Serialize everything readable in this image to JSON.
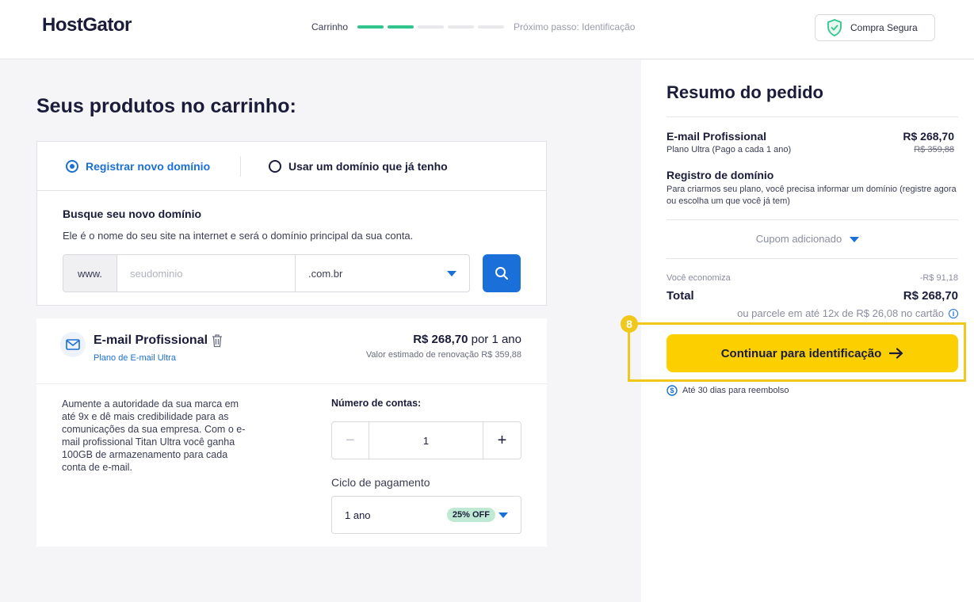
{
  "header": {
    "logo": "HostGator",
    "steps": {
      "current_label": "Carrinho",
      "next_label": "Próximo passo: Identificação",
      "total": 5,
      "completed": 2
    },
    "secure_label": "Compra Segura"
  },
  "main": {
    "title": "Seus produtos no carrinho:",
    "domain": {
      "tabs": [
        {
          "label": "Registrar novo domínio",
          "selected": true
        },
        {
          "label": "Usar um domínio que já tenho",
          "selected": false
        }
      ],
      "search_title": "Busque seu novo domínio",
      "search_desc": "Ele é o nome do seu site na internet e será o domínio principal da sua conta.",
      "prefix": "www.",
      "placeholder": "seudominio",
      "tld": ".com.br"
    },
    "product": {
      "name": "E-mail Profissional",
      "plan_link": "Plano de E-mail Ultra",
      "price": "R$ 268,70",
      "period": "por 1 ano",
      "renewal": "Valor estimado de renovação R$ 359,88",
      "description": "Aumente a autoridade da sua marca em até 9x e dê mais credibilidade para as comunicações da sua empresa. Com o e-mail profissional Titan Ultra você ganha 100GB de armazenamento para cada conta de e-mail.",
      "accounts_label": "Número de contas:",
      "accounts_value": "1",
      "minus": "−",
      "plus": "+",
      "cycle_label": "Ciclo de pagamento",
      "cycle_value": "1 ano",
      "cycle_badge": "25% OFF"
    }
  },
  "summary": {
    "title": "Resumo do pedido",
    "item": {
      "title": "E-mail Profissional",
      "subtitle": "Plano Ultra (Pago a cada 1 ano)",
      "price": "R$ 268,70",
      "old_price": "R$ 359,88"
    },
    "registration": {
      "title": "Registro de domínio",
      "desc": "Para criarmos seu plano, você precisa informar um domínio (registre agora ou escolha um que você já tem)"
    },
    "coupon": "Cupom adicionado",
    "savings_label": "Você economiza",
    "savings_value": "-R$ 91,18",
    "total_label": "Total",
    "total_value": "R$ 268,70",
    "installments": "ou parcele em até 12x de R$ 26,08 no cartão",
    "cta": "Continuar para identificação",
    "refund": "Até 30 dias para reembolso",
    "highlight_badge": "8"
  },
  "colors": {
    "primary": "#1a6fd8",
    "cta": "#fcd000",
    "progress": "#32c48d",
    "highlight": "#f0c81c",
    "dark": "#1a1c3a"
  }
}
